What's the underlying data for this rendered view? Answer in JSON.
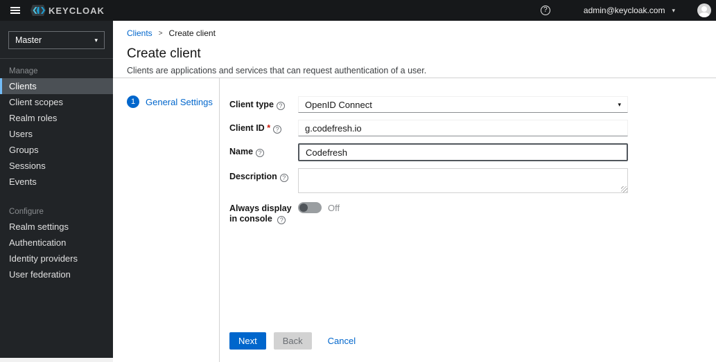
{
  "masthead": {
    "brand": "KEYCLOAK",
    "user_email": "admin@keycloak.com"
  },
  "icons": {
    "help_glyph": "?",
    "caret_glyph": "▾",
    "breadcrumb_separator": ">"
  },
  "sidebar": {
    "realm_selector": "Master",
    "sections": [
      {
        "label": "Manage",
        "items": [
          {
            "label": "Clients"
          },
          {
            "label": "Client scopes"
          },
          {
            "label": "Realm roles"
          },
          {
            "label": "Users"
          },
          {
            "label": "Groups"
          },
          {
            "label": "Sessions"
          },
          {
            "label": "Events"
          }
        ]
      },
      {
        "label": "Configure",
        "items": [
          {
            "label": "Realm settings"
          },
          {
            "label": "Authentication"
          },
          {
            "label": "Identity providers"
          },
          {
            "label": "User federation"
          }
        ]
      }
    ]
  },
  "breadcrumb": {
    "parent": "Clients",
    "current": "Create client"
  },
  "page": {
    "title": "Create client",
    "subtitle": "Clients are applications and services that can request authentication of a user."
  },
  "wizard": {
    "step_number": "1",
    "step_label": "General Settings"
  },
  "form": {
    "fields": [
      {
        "label": "Client type",
        "value": "OpenID Connect",
        "type": "select"
      },
      {
        "label": "Client ID",
        "required_marker": "*",
        "value": "g.codefresh.io",
        "type": "text"
      },
      {
        "label": "Name",
        "value": "Codefresh",
        "type": "text"
      },
      {
        "label": "Description",
        "value": "",
        "type": "textarea"
      },
      {
        "label": "Always display in console",
        "type": "switch",
        "state": "Off"
      }
    ],
    "buttons": {
      "next": "Next",
      "back": "Back",
      "cancel": "Cancel"
    }
  },
  "colors": {
    "masthead_bg": "#16181a",
    "sidebar_bg": "#212427",
    "active_nav_bg": "#4b5055",
    "active_nav_border": "#73bcf7",
    "primary_blue": "#0066cc",
    "required_red": "#c9190b"
  }
}
